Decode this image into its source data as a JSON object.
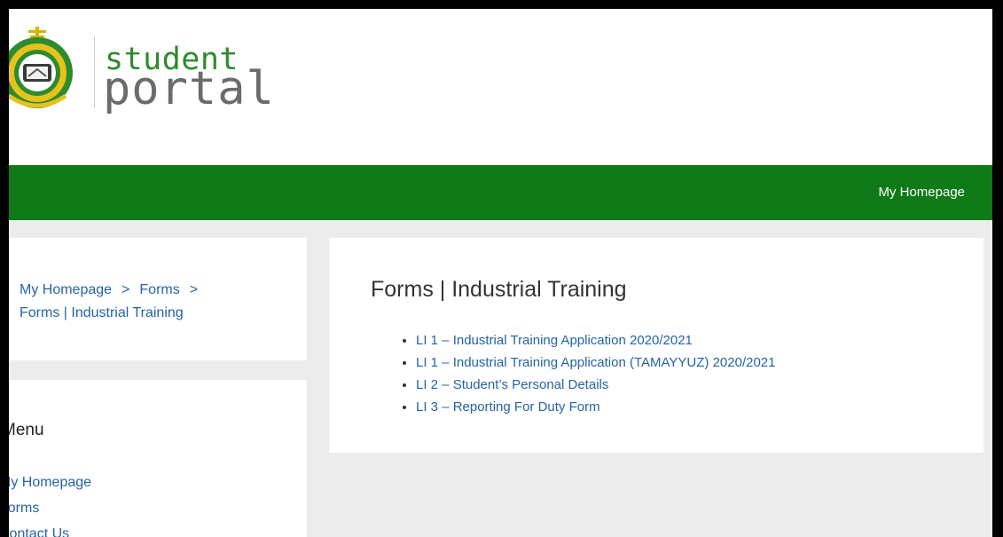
{
  "logo": {
    "line1": "student",
    "line2": "portal"
  },
  "navbar": {
    "home_link": "My Homepage"
  },
  "breadcrumb": {
    "items": [
      "My Homepage",
      "Forms",
      "Forms | Industrial Training"
    ],
    "separator": ">"
  },
  "menu": {
    "title": "Menu",
    "items": [
      "My Homepage",
      "Forms",
      "Contact Us"
    ]
  },
  "content": {
    "title": "Forms | Industrial Training",
    "links": [
      "LI 1 – Industrial Training Application 2020/2021",
      "LI 1 – Industrial Training Application (TAMAYYUZ) 2020/2021",
      "LI 2 – Student’s Personal Details",
      "LI 3 – Reporting For Duty Form"
    ]
  },
  "colors": {
    "nav_green": "#0f7a17",
    "link_blue": "#2563a6",
    "logo_green": "#2f8a2c",
    "logo_grey": "#6b6b6b"
  }
}
